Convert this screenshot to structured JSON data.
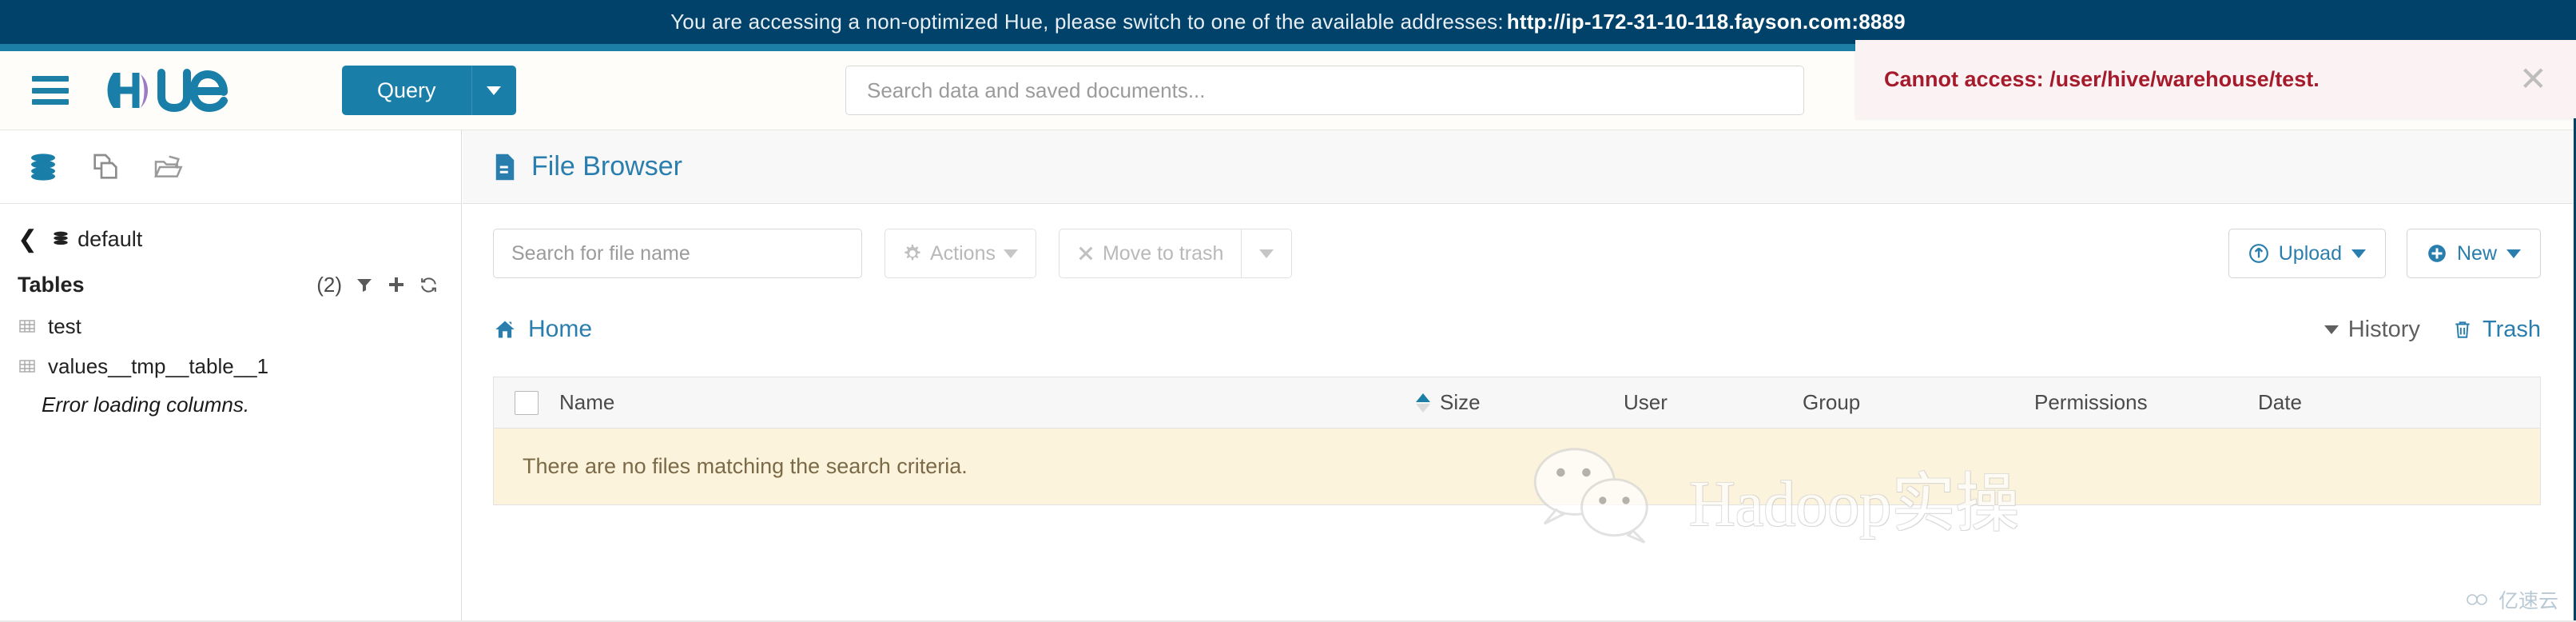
{
  "banner": {
    "message": "You are accessing a non-optimized Hue, please switch to one of the available addresses:",
    "url": "http://ip-172-31-10-118.fayson.com:8889",
    "bg_color": "#01426a",
    "stripe_color": "#1c7fa6"
  },
  "navbar": {
    "menu_icon": "hamburger-icon",
    "logo_text": "Hue",
    "query_label": "Query",
    "query_caret": "caret-down-icon",
    "search_placeholder": "Search data and saved documents...",
    "search_value": ""
  },
  "toast": {
    "message": "Cannot access: /user/hive/warehouse/test.",
    "close_label": "✕",
    "text_color": "#a61b2b",
    "bg_color": "#fbf2f3"
  },
  "sidebar": {
    "icons": [
      {
        "name": "database-icon",
        "active": true
      },
      {
        "name": "documents-icon",
        "active": false
      },
      {
        "name": "open-folder-icon",
        "active": false
      }
    ],
    "back_icon": "chevron-left-icon",
    "database_name": "default",
    "tables_label": "Tables",
    "tables_count": "(2)",
    "actions": [
      {
        "name": "filter-icon"
      },
      {
        "name": "add-icon"
      },
      {
        "name": "refresh-icon"
      }
    ],
    "tables": [
      {
        "name": "test"
      },
      {
        "name": "values__tmp__table__1"
      }
    ],
    "error_text": "Error loading columns."
  },
  "page": {
    "title": "File Browser",
    "title_icon": "file-icon",
    "title_color": "#2a7eae"
  },
  "toolbar": {
    "search_placeholder": "Search for file name",
    "search_value": "",
    "actions_label": "Actions",
    "actions_icon": "gear-icon",
    "move_to_trash_label": "Move to trash",
    "move_to_trash_icon": "close-x-icon",
    "split_caret": "caret-down-icon",
    "upload_label": "Upload",
    "upload_icon": "upload-circle-icon",
    "new_label": "New",
    "new_icon": "plus-circle-icon"
  },
  "breadcrumb": {
    "home_label": "Home",
    "home_icon": "home-icon",
    "history_label": "History",
    "history_icon": "caret-down-icon",
    "trash_label": "Trash",
    "trash_icon": "trash-icon"
  },
  "file_table": {
    "columns": [
      "Name",
      "Size",
      "User",
      "Group",
      "Permissions",
      "Date"
    ],
    "sort_column": "Size",
    "sort_direction": "asc",
    "rows": [],
    "empty_message": "There are no files matching the search criteria."
  },
  "watermark": {
    "text": "Hadoop实操",
    "wechat_icon": "wechat-icon",
    "corner_text": "亿速云",
    "corner_icon": "cloud-icon"
  }
}
